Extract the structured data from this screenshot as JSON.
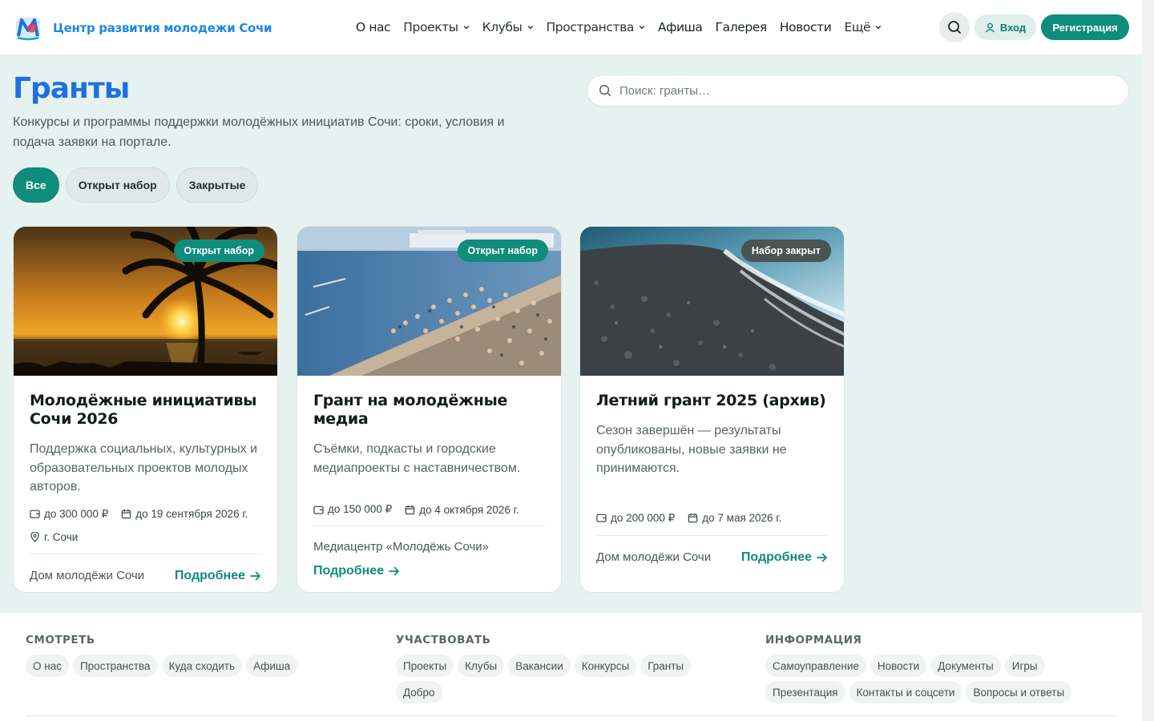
{
  "header": {
    "brand": "Центр развития молодежи Сочи",
    "nav": [
      {
        "label": "О нас",
        "dropdown": false
      },
      {
        "label": "Проекты",
        "dropdown": true
      },
      {
        "label": "Клубы",
        "dropdown": true
      },
      {
        "label": "Пространства",
        "dropdown": true
      },
      {
        "label": "Афиша",
        "dropdown": false
      },
      {
        "label": "Галерея",
        "dropdown": false
      },
      {
        "label": "Новости",
        "dropdown": false
      },
      {
        "label": "Ещё",
        "dropdown": true
      }
    ],
    "login_label": "Вход",
    "register_label": "Регистрация"
  },
  "page": {
    "title": "Гранты",
    "subtitle": "Конкурсы и программы поддержки молодёжных инициатив Сочи: сроки, условия и подача заявки на портале.",
    "search_placeholder": "Поиск: гранты…",
    "filters": [
      {
        "label": "Все",
        "active": true
      },
      {
        "label": "Открыт набор",
        "active": false
      },
      {
        "label": "Закрытые",
        "active": false
      }
    ]
  },
  "cards": [
    {
      "badge": "Открыт набор",
      "status": "open",
      "title": "Молодёжные инициативы Сочи 2026",
      "description": "Поддержка социальных, культурных и образовательных проектов молодых авторов.",
      "amount": "до 300 000 ₽",
      "deadline": "до 19 сентября 2026 г.",
      "location": "г. Сочи",
      "organizer": "Дом молодёжи Сочи",
      "more_label": "Подробнее"
    },
    {
      "badge": "Открыт набор",
      "status": "open",
      "title": "Грант на молодёжные медиа",
      "description": "Съёмки, подкасты и городские медиапроекты с наставничеством.",
      "amount": "до 150 000 ₽",
      "deadline": "до 4 октября 2026 г.",
      "organizer": "Медиацентр «Молодёжь Сочи»",
      "more_label": "Подробнее"
    },
    {
      "badge": "Набор закрыт",
      "status": "closed",
      "title": "Летний грант 2025 (архив)",
      "description": "Сезон завершён — результаты опубликованы, новые заявки не принимаются.",
      "amount": "до 200 000 ₽",
      "deadline": "до 7 мая 2026 г.",
      "organizer": "Дом молодёжи Сочи",
      "more_label": "Подробнее"
    }
  ],
  "footer": {
    "columns": [
      {
        "heading": "СМОТРЕТЬ",
        "links": [
          "О нас",
          "Пространства",
          "Куда сходить",
          "Афиша"
        ]
      },
      {
        "heading": "УЧАСТВОВАТЬ",
        "links": [
          "Проекты",
          "Клубы",
          "Вакансии",
          "Конкурсы",
          "Гранты",
          "Добро"
        ]
      },
      {
        "heading": "ИНФОРМАЦИЯ",
        "links": [
          "Самоуправление",
          "Новости",
          "Документы",
          "Игры",
          "Презентация",
          "Контакты и соцсети",
          "Вопросы и ответы"
        ]
      }
    ]
  },
  "colors": {
    "accent": "#0f8c7c",
    "title_blue": "#1e6fe0",
    "background": "#e6f2ef"
  }
}
